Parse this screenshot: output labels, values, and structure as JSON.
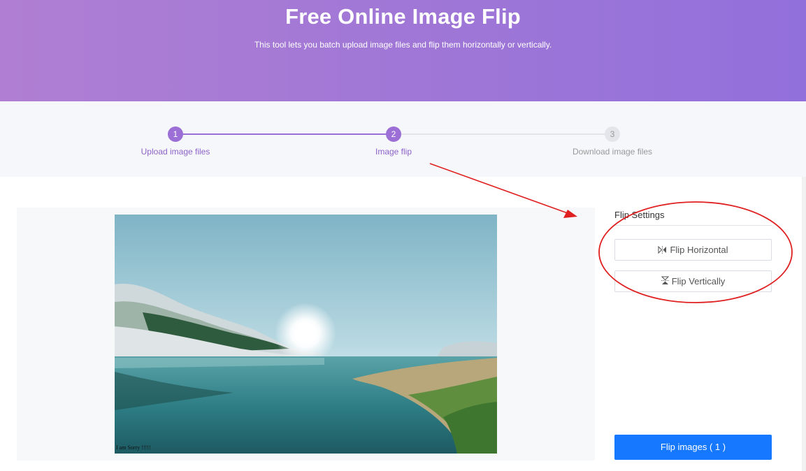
{
  "header": {
    "title": "Free Online Image Flip",
    "subtitle": "This tool lets you batch upload image files and flip them horizontally or vertically."
  },
  "steps": [
    {
      "number": "1",
      "label": "Upload image files",
      "state": "done"
    },
    {
      "number": "2",
      "label": "Image flip",
      "state": "active"
    },
    {
      "number": "3",
      "label": "Download image files",
      "state": "pending"
    }
  ],
  "preview": {
    "watermark_text": "I am Sorry !!!!!"
  },
  "settings": {
    "title": "Flip Settings",
    "flip_horizontal_label": "Flip Horizontal",
    "flip_vertical_label": "Flip Vertically"
  },
  "actions": {
    "flip_images_label": "Flip images ( 1 )"
  },
  "colors": {
    "accent": "#9b6fd6",
    "primary": "#1677ff",
    "annotation": "#e02020"
  }
}
